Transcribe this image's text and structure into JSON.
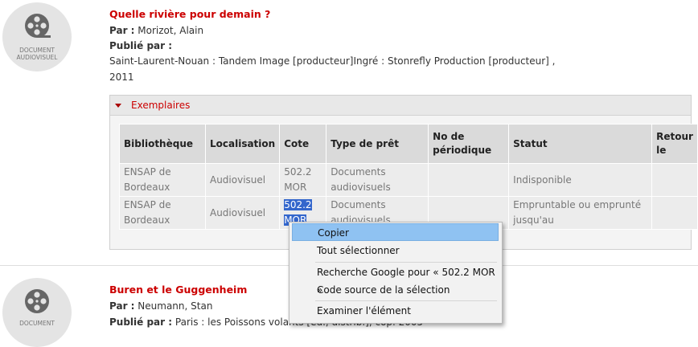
{
  "record1": {
    "thumb_caption_1": "DOCUMENT",
    "thumb_caption_2": "AUDIOVISUEL",
    "title": "Quelle rivière pour demain ?",
    "author_label": "Par :",
    "author": "Morizot, Alain",
    "published_label": "Publié par :",
    "publisher": "Saint-Laurent-Nouan : Tandem Image [producteur]Ingré : Stonrefly Production [producteur] ,",
    "year": "2011"
  },
  "exemplaires": {
    "label": "Exemplaires",
    "headers": [
      "Bibliothèque",
      "Localisation",
      "Cote",
      "Type de prêt",
      "No de périodique",
      "Statut",
      "Retour le"
    ],
    "rows": [
      {
        "bibliotheque": "ENSAP de Bordeaux",
        "localisation": "Audiovisuel",
        "cote_1": "502.2",
        "cote_2": "MOR",
        "type": "Documents audiovisuels",
        "no": "",
        "statut": "Indisponible",
        "retour": ""
      },
      {
        "bibliotheque": "ENSAP de Bordeaux",
        "localisation": "Audiovisuel",
        "cote_1": "502.2",
        "cote_2": "MOR",
        "type": "Documents audiovisuels",
        "no": "",
        "statut": "Empruntable ou emprunté jusqu'au",
        "retour": ""
      }
    ]
  },
  "context_menu": {
    "items": [
      {
        "label": "Copier",
        "highlighted": true
      },
      {
        "label": "Tout sélectionner"
      },
      {
        "label": "Recherche Google pour « 502.2 MOR »"
      },
      {
        "label": "Code source de la sélection"
      },
      {
        "label": "Examiner l'élément"
      }
    ]
  },
  "record2": {
    "thumb_caption_1": "DOCUMENT",
    "title": "Buren et le Guggenheim",
    "author_label": "Par :",
    "author": "Neumann, Stan",
    "published_label": "Publié par :",
    "publisher": "Paris : les Poissons volants [éd., distrib.], cop. 2005"
  },
  "colors": {
    "accent": "#cc0000",
    "selection": "#3366cc",
    "menu_highlight": "#8fc2f2"
  }
}
